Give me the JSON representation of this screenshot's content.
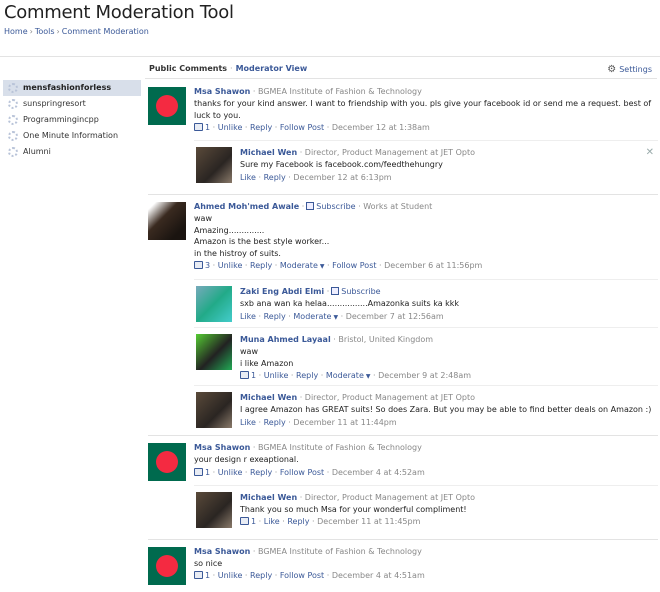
{
  "header": {
    "title": "Comment Moderation Tool",
    "breadcrumb": [
      "Home",
      "Tools",
      "Comment Moderation"
    ]
  },
  "sidebar": {
    "items": [
      {
        "label": "mensfashionforless",
        "active": true
      },
      {
        "label": "sunspringresort"
      },
      {
        "label": "Programmingincpp"
      },
      {
        "label": "One Minute Information"
      },
      {
        "label": "Alumni"
      }
    ]
  },
  "tabs": {
    "public": "Public Comments",
    "moderator": "Moderator View",
    "separator": "·"
  },
  "settings_label": "Settings",
  "comments": [
    {
      "author": "Msa Shawon",
      "meta": "BGMEA Institute of Fashion & Technology",
      "text": "thanks for your kind answer. I want to friendship with you. pls give your facebook id or send me a request. best of luck to you.",
      "likes": "1",
      "a1": "Unlike",
      "a2": "Reply",
      "a3": "Follow Post",
      "time": "December 12 at 1:38am",
      "replies": [
        {
          "author": "Michael Wen",
          "meta": "Director, Product Management at JET Opto",
          "text": "Sure my Facebook is facebook.com/feedthehungry",
          "a1": "Like",
          "a2": "Reply",
          "time": "December 12 at 6:13pm"
        }
      ]
    },
    {
      "author": "Ahmed Moh'med Awale",
      "subscribe": "Subscribe",
      "meta": "Works at Student",
      "lines": [
        "waw",
        "Amazing..............",
        "Amazon is the best style worker...",
        "in the histroy of suits."
      ],
      "likes": "3",
      "a1": "Unlike",
      "a2": "Reply",
      "a3": "Moderate",
      "a4": "Follow Post",
      "time": "December 6 at 11:56pm",
      "replies": [
        {
          "author": "Zaki Eng Abdi Elmi",
          "subscribe": "Subscribe",
          "text": "sxb ana wan ka helaa................Amazonka suits ka kkk",
          "a1": "Like",
          "a2": "Reply",
          "a3": "Moderate",
          "time": "December 7 at 12:56am"
        },
        {
          "author": "Muna Ahmed Layaal",
          "meta": "Bristol, United Kingdom",
          "lines": [
            "waw",
            "i like Amazon"
          ],
          "likes": "1",
          "a1": "Unlike",
          "a2": "Reply",
          "a3": "Moderate",
          "time": "December 9 at 2:48am"
        },
        {
          "author": "Michael Wen",
          "meta": "Director, Product Management at JET Opto",
          "text": "I agree Amazon has GREAT suits! So does Zara. But you may be able to find better deals on Amazon :)",
          "a1": "Like",
          "a2": "Reply",
          "time": "December 11 at 11:44pm"
        }
      ]
    },
    {
      "author": "Msa Shawon",
      "meta": "BGMEA Institute of Fashion & Technology",
      "text": "your design r exeaptional.",
      "likes": "1",
      "a1": "Unlike",
      "a2": "Reply",
      "a3": "Follow Post",
      "time": "December 4 at 4:52am",
      "replies": [
        {
          "author": "Michael Wen",
          "meta": "Director, Product Management at JET Opto",
          "text": "Thank you so much Msa for your wonderful compliment!",
          "likes": "1",
          "a1": "Like",
          "a2": "Reply",
          "time": "December 11 at 11:45pm"
        }
      ]
    },
    {
      "author": "Msa Shawon",
      "meta": "BGMEA Institute of Fashion & Technology",
      "text": "so nice",
      "likes": "1",
      "a1": "Unlike",
      "a2": "Reply",
      "a3": "Follow Post",
      "time": "December 4 at 4:51am"
    }
  ]
}
